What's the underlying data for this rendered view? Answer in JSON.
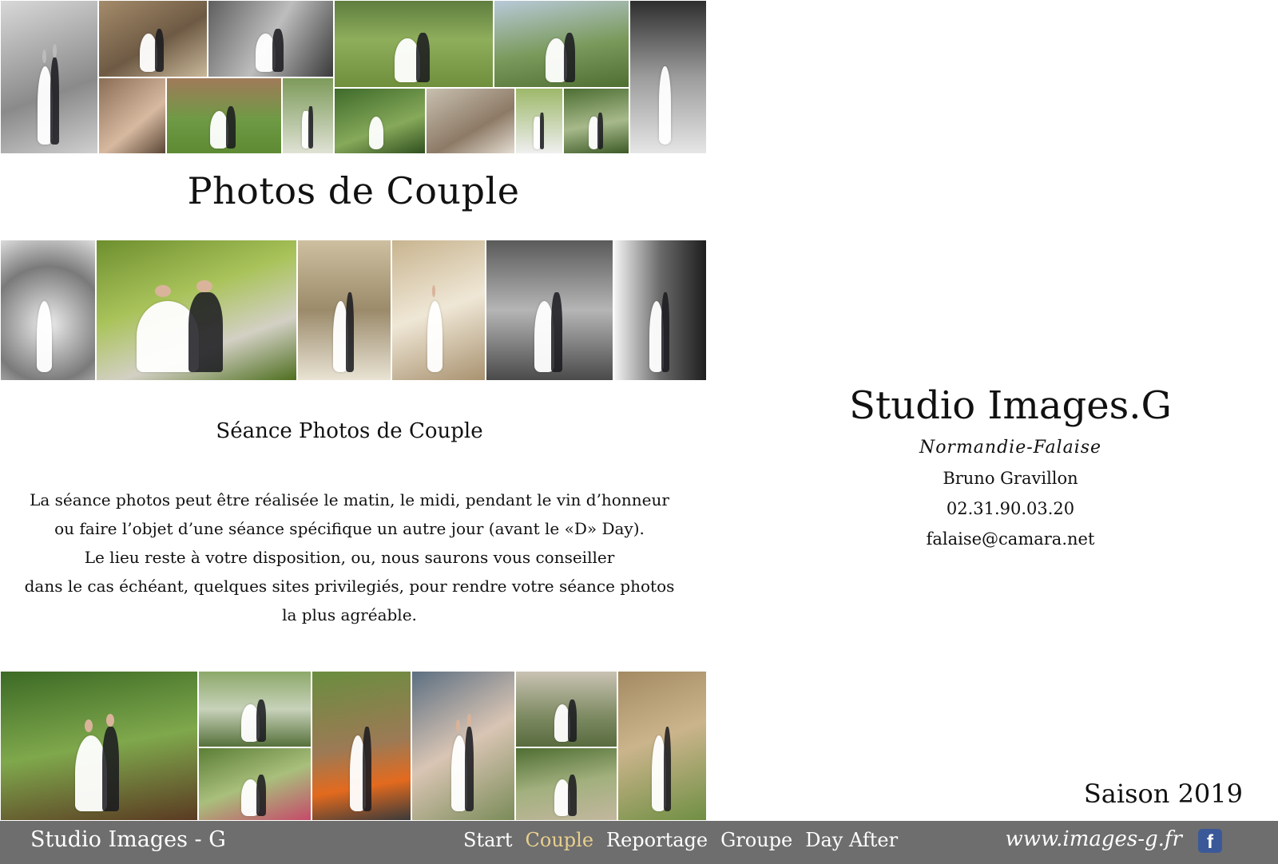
{
  "main": {
    "title": "Photos de Couple",
    "subtitle": "Séance Photos de Couple",
    "description": [
      "La séance photos peut être réalisée le matin, le midi,  pendant le vin d’honneur",
      "ou faire l’objet d’une séance  spécifique un autre jour (avant le «D» Day).",
      "Le lieu reste à votre disposition, ou, nous saurons vous conseiller",
      "dans le cas échéant, quelques sites privilegiés, pour rendre votre séance photos",
      "la plus agréable."
    ]
  },
  "studio": {
    "name": "Studio Images.G",
    "region": "Normandie-Falaise",
    "owner": "Bruno Gravillon",
    "phone": "02.31.90.03.20",
    "email": "falaise@camara.net"
  },
  "season": "Saison 2019",
  "footer": {
    "brand": "Studio Images - G",
    "nav": [
      {
        "label": "Start",
        "active": false
      },
      {
        "label": "Couple",
        "active": true
      },
      {
        "label": "Reportage",
        "active": false
      },
      {
        "label": "Groupe",
        "active": false
      },
      {
        "label": "Day After",
        "active": false
      }
    ],
    "site": "www.images-g.fr",
    "facebook_icon": "facebook-icon"
  },
  "colors": {
    "footer_bg": "#6e6e6e",
    "nav_active": "#e8cf8e",
    "facebook": "#3b5998"
  }
}
